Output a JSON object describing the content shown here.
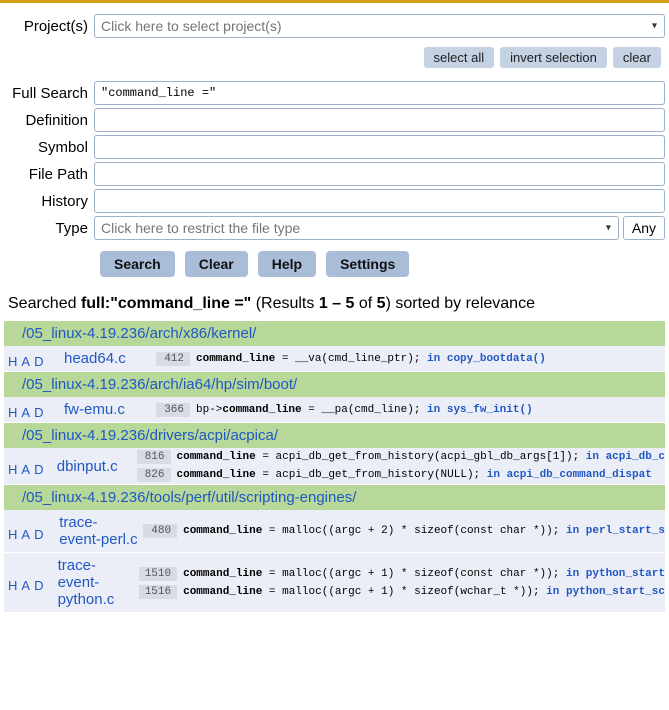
{
  "form": {
    "projects_label": "Project(s)",
    "projects_placeholder": "Click here to select project(s)",
    "select_all": "select all",
    "invert_selection": "invert selection",
    "clear": "clear",
    "full_search_label": "Full Search",
    "full_search_value": "\"command_line =\"",
    "definition_label": "Definition",
    "symbol_label": "Symbol",
    "file_path_label": "File Path",
    "history_label": "History",
    "type_label": "Type",
    "type_placeholder": "Click here to restrict the file type",
    "any_label": "Any",
    "search_btn": "Search",
    "clear_btn": "Clear",
    "help_btn": "Help",
    "settings_btn": "Settings"
  },
  "summary": {
    "prefix": "Searched ",
    "query_label": "full:\"command_line =\"",
    "mid1": " (Results ",
    "range": "1 – 5",
    "mid2": " of ",
    "total": "5",
    "suffix": ") sorted by relevance"
  },
  "had_letters": [
    "H",
    "A",
    "D"
  ],
  "results": [
    {
      "dir": "/05_linux-4.19.236/arch/x86/kernel/",
      "files": [
        {
          "name": "head64.c",
          "lines": [
            {
              "no": "412",
              "code_html": "<b>command_line</b> = __va(cmd_line_ptr);  <span class='fn'>in copy_bootdata()</span>"
            }
          ]
        }
      ]
    },
    {
      "dir": "/05_linux-4.19.236/arch/ia64/hp/sim/boot/",
      "files": [
        {
          "name": "fw-emu.c",
          "lines": [
            {
              "no": "366",
              "code_html": "bp-><b>command_line</b> = __pa(cmd_line);  <span class='fn'>in sys_fw_init()</span>"
            }
          ]
        }
      ]
    },
    {
      "dir": "/05_linux-4.19.236/drivers/acpi/acpica/",
      "files": [
        {
          "name": "dbinput.c",
          "lines": [
            {
              "no": "816",
              "code_html": "<b>command_line</b> = acpi_db_get_from_history(acpi_gbl_db_args[1]);  <span class='fn'>in acpi_db_c</span>"
            },
            {
              "no": "826",
              "code_html": "<b>command_line</b> = acpi_db_get_from_history(NULL);  <span class='fn'>in acpi_db_command_dispat</span>"
            }
          ]
        }
      ]
    },
    {
      "dir": "/05_linux-4.19.236/tools/perf/util/scripting-engines/",
      "files": [
        {
          "name": "trace-event-perl.c",
          "lines": [
            {
              "no": "480",
              "code_html": "<b>command_line</b> = malloc((argc + 2) * sizeof(const char *));  <span class='fn'>in perl_start_s</span>"
            }
          ]
        },
        {
          "name": "trace-event-python.c",
          "lines": [
            {
              "no": "1510",
              "code_html": "<b>command_line</b> = malloc((argc + 1) * sizeof(const char *));  <span class='fn'>in python_start</span>"
            },
            {
              "no": "1516",
              "code_html": "<b>command_line</b> = malloc((argc + 1) * sizeof(wchar_t *));  <span class='fn'>in python_start_sc</span>"
            }
          ]
        }
      ]
    }
  ]
}
